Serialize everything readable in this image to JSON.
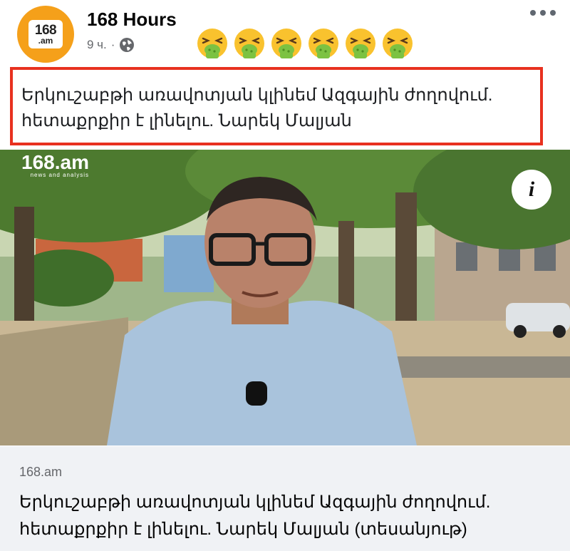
{
  "post": {
    "page_name": "168 Hours",
    "time": "9 ч.",
    "separator": "·",
    "privacy_icon": "globe-icon",
    "reaction_emoji": [
      "vomiting-face",
      "vomiting-face",
      "vomiting-face",
      "vomiting-face",
      "vomiting-face",
      "vomiting-face"
    ],
    "more_icon": "more-options-icon"
  },
  "avatar": {
    "logo_line1": "168",
    "logo_line2": ".am",
    "bg": "#f5a01a"
  },
  "headline": {
    "line1": "Երկուշաբթի առավոտյան կլինեմ Ազգային ժողովում.",
    "line2": "հետաքրքիր է լինելու. Նարեկ Մալյան",
    "border_color": "#e8311f"
  },
  "video": {
    "watermark": "168.am",
    "watermark_sub": "news and analysis",
    "info_icon_label": "i"
  },
  "link": {
    "domain": "168.am",
    "title": "Երկուշաբթի առավոտյան կլինեմ Ազգային ժողովում. հետաքրքիր է լինելու. Նարեկ Մալյան (տեսանյութ)"
  }
}
